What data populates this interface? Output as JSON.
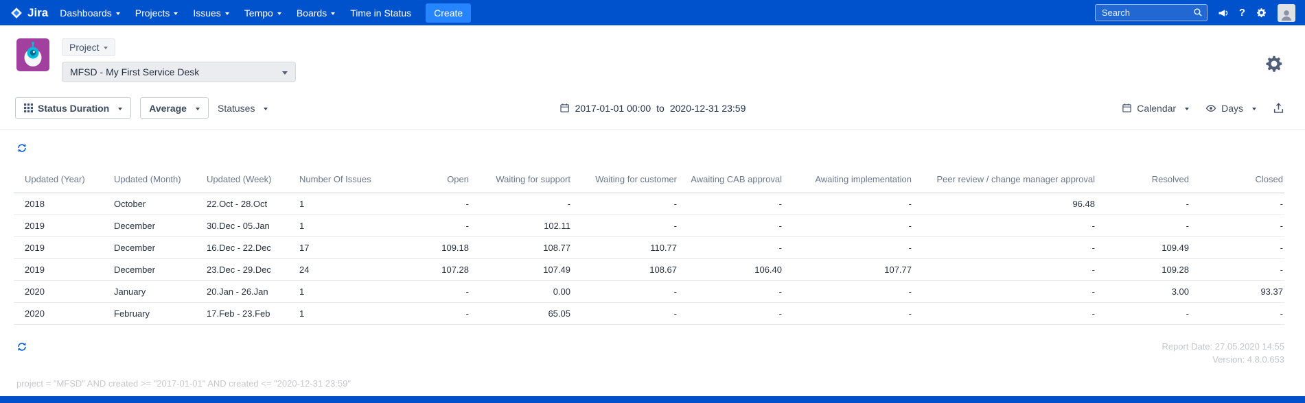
{
  "nav": {
    "brand": "Jira",
    "items": [
      {
        "label": "Dashboards"
      },
      {
        "label": "Projects"
      },
      {
        "label": "Issues"
      },
      {
        "label": "Tempo"
      },
      {
        "label": "Boards"
      },
      {
        "label": "Time in Status"
      }
    ],
    "create_label": "Create",
    "search_placeholder": "Search"
  },
  "header": {
    "project_button_label": "Project",
    "project_select_value": "MFSD - My First Service Desk"
  },
  "toolbar": {
    "status_duration_label": "Status Duration",
    "average_label": "Average",
    "statuses_label": "Statuses",
    "date_from": "2017-01-01 00:00",
    "date_to_label": "to",
    "date_to": "2020-12-31 23:59",
    "calendar_label": "Calendar",
    "days_label": "Days"
  },
  "table": {
    "columns": [
      "Updated (Year)",
      "Updated (Month)",
      "Updated (Week)",
      "Number Of Issues",
      "Open",
      "Waiting for support",
      "Waiting for customer",
      "Awaiting CAB approval",
      "Awaiting implementation",
      "Peer review / change manager approval",
      "Resolved",
      "Closed"
    ],
    "rows": [
      [
        "2018",
        "October",
        "22.Oct - 28.Oct",
        "1",
        "-",
        "-",
        "-",
        "-",
        "-",
        "96.48",
        "-",
        "-"
      ],
      [
        "2019",
        "December",
        "30.Dec - 05.Jan",
        "1",
        "-",
        "102.11",
        "-",
        "-",
        "-",
        "-",
        "-",
        "-"
      ],
      [
        "2019",
        "December",
        "16.Dec - 22.Dec",
        "17",
        "109.18",
        "108.77",
        "110.77",
        "-",
        "-",
        "-",
        "109.49",
        "-"
      ],
      [
        "2019",
        "December",
        "23.Dec - 29.Dec",
        "24",
        "107.28",
        "107.49",
        "108.67",
        "106.40",
        "107.77",
        "-",
        "109.28",
        "-"
      ],
      [
        "2020",
        "January",
        "20.Jan - 26.Jan",
        "1",
        "-",
        "0.00",
        "-",
        "-",
        "-",
        "-",
        "3.00",
        "93.37"
      ],
      [
        "2020",
        "February",
        "17.Feb - 23.Feb",
        "1",
        "-",
        "65.05",
        "-",
        "-",
        "-",
        "-",
        "-",
        "-"
      ]
    ]
  },
  "footer": {
    "report_date": "Report Date: 27.05.2020 14:55",
    "version": "Version: 4.8.0.653",
    "query": "project = \"MFSD\" AND created >= \"2017-01-01\" AND created <= \"2020-12-31 23:59\""
  },
  "icons": {
    "help": "?",
    "search": "magnifier",
    "refresh": "circular-arrows",
    "calendar": "calendar-grid",
    "eye": "eye",
    "export": "tray-up-arrow",
    "gear": "gear",
    "grid": "3x3-grid",
    "megaphone": "megaphone",
    "caret": "chevron-down"
  },
  "colors": {
    "nav_bg": "#0052CC",
    "create_button_bg": "#2684FF",
    "accent_blue": "#0052CC",
    "table_header_text": "#6B778C",
    "table_cell_text": "#26313F",
    "muted_text": "#C2C5CA",
    "avatar_purple": "#A1409F",
    "avatar_teal": "#00B8D9"
  }
}
